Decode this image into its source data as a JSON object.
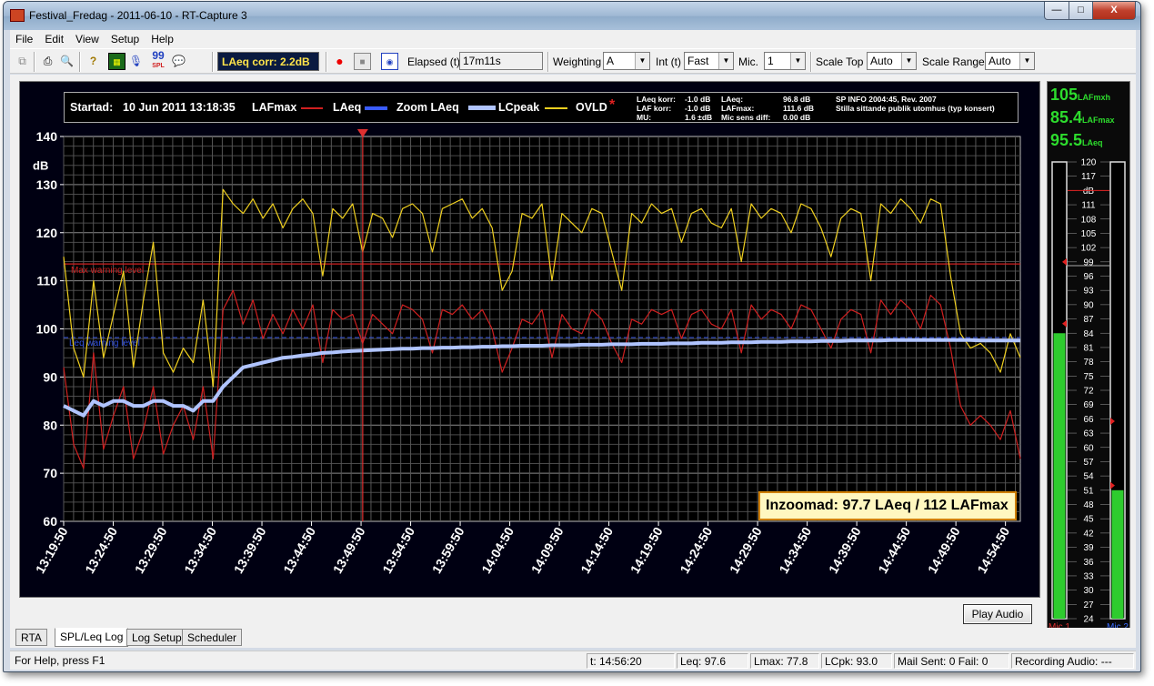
{
  "window": {
    "title": "Festival_Fredag - 2011-06-10 - RT-Capture 3",
    "min_label": "—",
    "max_label": "□",
    "close_label": "X"
  },
  "menu": [
    "File",
    "Edit",
    "View",
    "Setup",
    "Help"
  ],
  "toolbar": {
    "spl_label": "SPL",
    "laeq_corr": "LAeq corr: 2.2dB",
    "elapsed_label": "Elapsed (t)",
    "elapsed_value": "17m11s",
    "weighting_label": "Weighting",
    "weighting_value": "A",
    "int_label": "Int (t)",
    "int_value": "Fast",
    "mic_label": "Mic.",
    "mic_value": "1",
    "scale_top_label": "Scale Top",
    "scale_top_value": "Auto",
    "scale_range_label": "Scale Range",
    "scale_range_value": "Auto"
  },
  "legend": {
    "startad_label": "Startad:",
    "startad_value": "10 Jun 2011  13:18:35",
    "series": [
      "LAFmax",
      "LAeq",
      "Zoom LAeq",
      "LCpeak",
      "OVLD"
    ],
    "info_col1": [
      "LAeq korr:",
      "LAF korr:",
      "MU:"
    ],
    "info_col2": [
      "-1.0 dB",
      "-1.0 dB",
      "1.6 ±dB"
    ],
    "info_col3": [
      "LAeq:",
      "LAFmax:",
      "Mic sens diff:"
    ],
    "info_col4": [
      "96.8 dB",
      "111.6 dB",
      "0.00 dB"
    ],
    "info_text1": "SP INFO 2004:45, Rev. 2007",
    "info_text2": "Stilla sittande publik utomhus (typ konsert)"
  },
  "zoom_box": "Inzoomad: 97.7 LAeq / 112 LAFmax",
  "chart_data": {
    "type": "line",
    "ylabel": "dB",
    "ylim": [
      60,
      140
    ],
    "yticks": [
      140,
      130,
      120,
      110,
      100,
      90,
      80,
      70,
      60
    ],
    "x_ticks": [
      "13:19:50",
      "13:24:50",
      "13:29:50",
      "13:34:50",
      "13:39:50",
      "13:44:50",
      "13:49:50",
      "13:54:50",
      "13:59:50",
      "14:04:50",
      "14:09:50",
      "14:14:50",
      "14:19:50",
      "14:24:50",
      "14:29:50",
      "14:34:50",
      "14:39:50",
      "14:44:50",
      "14:49:50",
      "14:54:50"
    ],
    "xlim": [
      "13:19:50",
      "14:56:20"
    ],
    "grid": true,
    "max_warning_level": {
      "label": "Max warning level",
      "value": 113.5,
      "color": "#d02020"
    },
    "leq_warning_level": {
      "label": "Leq warning level",
      "value": 98.2,
      "color": "#3050e0"
    },
    "cursor_time": "13:50:00",
    "series": [
      {
        "name": "LCpeak",
        "color": "#f0d020",
        "x": [
          0,
          1,
          2,
          3,
          4,
          5,
          6,
          7,
          8,
          9,
          10,
          11,
          12,
          13,
          14,
          15,
          16,
          17,
          18,
          19,
          20,
          21,
          22,
          23,
          24,
          25,
          26,
          27,
          28,
          29,
          30,
          31,
          32,
          33,
          34,
          35,
          36,
          37,
          38,
          39,
          40,
          41,
          42,
          43,
          44,
          45,
          46,
          47,
          48,
          49,
          50,
          51,
          52,
          53,
          54,
          55,
          56,
          57,
          58,
          59,
          60,
          61,
          62,
          63,
          64,
          65,
          66,
          67,
          68,
          69,
          70,
          71,
          72,
          73,
          74,
          75,
          76,
          77,
          78,
          79,
          80,
          81,
          82,
          83,
          84,
          85,
          86,
          87,
          88,
          89,
          90,
          91,
          92,
          93,
          94,
          95,
          96
        ],
        "values": [
          115,
          96,
          90,
          110,
          94,
          103,
          112,
          92,
          106,
          118,
          95,
          91,
          96,
          93,
          106,
          88,
          129,
          126,
          124,
          127,
          123,
          126,
          121,
          125,
          127,
          124,
          111,
          125,
          123,
          126,
          116,
          124,
          123,
          119,
          125,
          126,
          124,
          116,
          125,
          126,
          127,
          123,
          125,
          121,
          108,
          112,
          124,
          123,
          126,
          110,
          124,
          122,
          120,
          125,
          124,
          116,
          108,
          124,
          122,
          126,
          124,
          125,
          118,
          124,
          125,
          122,
          121,
          125,
          114,
          126,
          123,
          125,
          124,
          120,
          126,
          125,
          121,
          115,
          123,
          125,
          124,
          110,
          126,
          124,
          127,
          125,
          122,
          127,
          126,
          111,
          99,
          96,
          97,
          95,
          91,
          99,
          94
        ]
      },
      {
        "name": "LAFmax",
        "color": "#d02020",
        "x": [
          0,
          1,
          2,
          3,
          4,
          5,
          6,
          7,
          8,
          9,
          10,
          11,
          12,
          13,
          14,
          15,
          16,
          17,
          18,
          19,
          20,
          21,
          22,
          23,
          24,
          25,
          26,
          27,
          28,
          29,
          30,
          31,
          32,
          33,
          34,
          35,
          36,
          37,
          38,
          39,
          40,
          41,
          42,
          43,
          44,
          45,
          46,
          47,
          48,
          49,
          50,
          51,
          52,
          53,
          54,
          55,
          56,
          57,
          58,
          59,
          60,
          61,
          62,
          63,
          64,
          65,
          66,
          67,
          68,
          69,
          70,
          71,
          72,
          73,
          74,
          75,
          76,
          77,
          78,
          79,
          80,
          81,
          82,
          83,
          84,
          85,
          86,
          87,
          88,
          89,
          90,
          91,
          92,
          93,
          94,
          95,
          96
        ],
        "values": [
          92,
          76,
          71,
          95,
          75,
          82,
          88,
          73,
          79,
          88,
          74,
          80,
          84,
          77,
          88,
          73,
          104,
          108,
          101,
          106,
          98,
          103,
          99,
          104,
          100,
          105,
          93,
          104,
          102,
          103,
          97,
          103,
          101,
          99,
          105,
          104,
          102,
          95,
          104,
          103,
          105,
          102,
          104,
          100,
          91,
          96,
          102,
          101,
          104,
          94,
          103,
          100,
          99,
          104,
          102,
          97,
          93,
          102,
          101,
          104,
          103,
          104,
          98,
          103,
          104,
          101,
          100,
          104,
          95,
          105,
          102,
          104,
          103,
          100,
          105,
          104,
          100,
          96,
          102,
          104,
          103,
          95,
          106,
          103,
          106,
          104,
          100,
          107,
          105,
          96,
          84,
          80,
          82,
          80,
          77,
          83,
          73
        ]
      },
      {
        "name": "LAeq",
        "color": "#3a5cff",
        "x": [
          0,
          1,
          2,
          3,
          4,
          5,
          6,
          7,
          8,
          9,
          10,
          11,
          12,
          13,
          14,
          15,
          16,
          17,
          18,
          19,
          20,
          21,
          22,
          23,
          24,
          25,
          26,
          27,
          28,
          29,
          30,
          31,
          32,
          33,
          34,
          35,
          36,
          37,
          38,
          39,
          40,
          41,
          42,
          43,
          44,
          45,
          46,
          47,
          48,
          49,
          50,
          51,
          52,
          53,
          54,
          55,
          56,
          57,
          58,
          59,
          60,
          61,
          62,
          63,
          64,
          65,
          66,
          67,
          68,
          69,
          70,
          71,
          72,
          73,
          74,
          75,
          76,
          77,
          78,
          79,
          80,
          81,
          82,
          83,
          84,
          85,
          86,
          87,
          88,
          89,
          90,
          91,
          92,
          93,
          94,
          95,
          96
        ],
        "values": [
          84,
          83,
          82,
          85,
          84,
          85,
          85,
          84,
          84,
          85,
          85,
          84,
          84,
          83,
          85,
          85,
          88,
          90,
          92,
          92.5,
          93,
          93.5,
          94,
          94.2,
          94.5,
          94.7,
          95,
          95.1,
          95.3,
          95.4,
          95.5,
          95.6,
          95.7,
          95.8,
          95.9,
          95.9,
          96,
          96,
          96.1,
          96.1,
          96.2,
          96.2,
          96.3,
          96.3,
          96.4,
          96.4,
          96.5,
          96.5,
          96.5,
          96.6,
          96.6,
          96.6,
          96.7,
          96.7,
          96.7,
          96.8,
          96.8,
          96.8,
          96.9,
          96.9,
          96.9,
          97,
          97,
          97,
          97.1,
          97.1,
          97.1,
          97.2,
          97.2,
          97.2,
          97.3,
          97.3,
          97.3,
          97.4,
          97.4,
          97.4,
          97.5,
          97.5,
          97.5,
          97.6,
          97.6,
          97.6,
          97.6,
          97.7,
          97.7,
          97.7,
          97.7,
          97.7,
          97.7,
          97.7,
          97.7,
          97.7,
          97.6,
          97.6,
          97.6,
          97.6,
          97.6
        ]
      },
      {
        "name": "Zoom LAeq",
        "color": "#b0c4ff",
        "x": [
          0,
          1,
          2,
          3,
          4,
          5,
          6,
          7,
          8,
          9,
          10,
          11,
          12,
          13,
          14,
          15,
          16,
          17,
          18,
          19,
          20,
          21,
          22,
          23,
          24,
          25,
          26,
          27,
          28,
          29,
          30,
          31,
          32,
          33,
          34,
          35,
          36,
          37,
          38,
          39,
          40,
          41,
          42,
          43,
          44,
          45,
          46,
          47,
          48,
          49,
          50,
          51,
          52,
          53,
          54,
          55,
          56,
          57,
          58,
          59,
          60,
          61,
          62,
          63,
          64,
          65,
          66,
          67,
          68,
          69,
          70,
          71,
          72,
          73,
          74,
          75,
          76,
          77,
          78,
          79,
          80,
          81,
          82,
          83,
          84,
          85,
          86,
          87,
          88,
          89,
          90,
          91,
          92,
          93,
          94,
          95,
          96
        ],
        "values": [
          84,
          83,
          82,
          85,
          84,
          85,
          85,
          84,
          84,
          85,
          85,
          84,
          84,
          83,
          85,
          85,
          88,
          90,
          92,
          92.5,
          93,
          93.5,
          94,
          94.2,
          94.5,
          94.7,
          95,
          95.1,
          95.3,
          95.4,
          95.5,
          95.6,
          95.7,
          95.8,
          95.9,
          95.9,
          96,
          96,
          96.1,
          96.1,
          96.2,
          96.2,
          96.3,
          96.3,
          96.4,
          96.4,
          96.5,
          96.5,
          96.5,
          96.6,
          96.6,
          96.6,
          96.7,
          96.7,
          96.7,
          96.8,
          96.8,
          96.8,
          96.9,
          96.9,
          96.9,
          97,
          97,
          97,
          97.1,
          97.1,
          97.1,
          97.2,
          97.2,
          97.2,
          97.3,
          97.3,
          97.3,
          97.4,
          97.4,
          97.4,
          97.5,
          97.5,
          97.5,
          97.6,
          97.6,
          97.6,
          97.6,
          97.7,
          97.7,
          97.7,
          97.7,
          97.7,
          97.7,
          97.7,
          97.7,
          97.7,
          97.6,
          97.6,
          97.6,
          97.6,
          97.6
        ]
      }
    ]
  },
  "meter": {
    "lafmxh_value": "105",
    "lafmxh_label": "LAFmxh",
    "lafmax_value": "85.4",
    "lafmax_label": "LAFmax",
    "laeq_value": "95.5",
    "laeq_label": "LAeq",
    "scale": [
      "120",
      "117",
      "dB",
      "111",
      "108",
      "105",
      "102",
      "99",
      "96",
      "93",
      "90",
      "87",
      "84",
      "81",
      "78",
      "75",
      "72",
      "69",
      "66",
      "63",
      "60",
      "57",
      "54",
      "51",
      "48",
      "45",
      "42",
      "39",
      "36",
      "33",
      "30",
      "27",
      "24"
    ],
    "mic1_level": 84,
    "mic2_level": 51,
    "mic1_label": "Mic 1",
    "mic2_label": "Mic 2"
  },
  "play_audio": "Play Audio",
  "tabs": [
    "RTA",
    "SPL/Leq Log",
    "Log Setup",
    "Scheduler"
  ],
  "status": {
    "help": "For Help, press F1",
    "time": "t: 14:56:20",
    "leq": "Leq: 97.6",
    "lmax": "Lmax: 77.8",
    "lcpk": "LCpk: 93.0",
    "mail": "Mail Sent: 0 Fail: 0",
    "recording": "Recording Audio: ---"
  }
}
